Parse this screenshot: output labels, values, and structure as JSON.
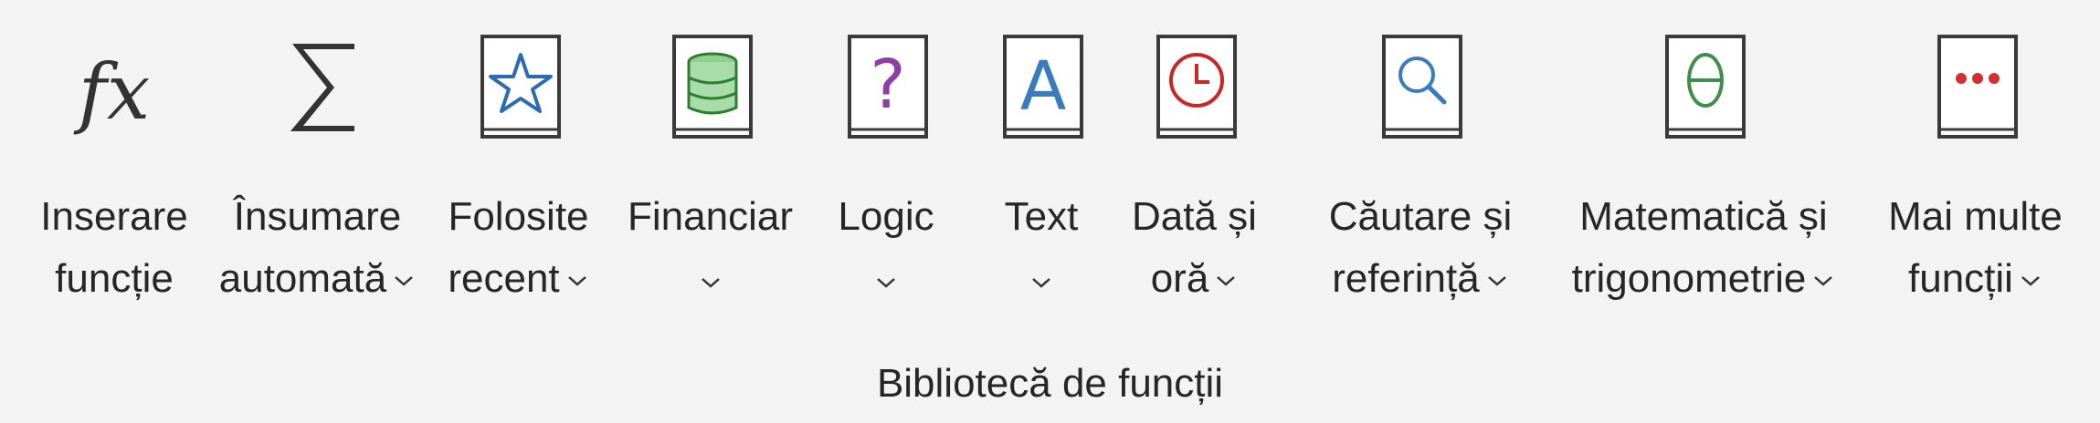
{
  "ribbon_group": {
    "label": "Bibliotecă de funcții",
    "commands": [
      {
        "line1": "Inserare",
        "line2": "funcție",
        "icon": "function-fx-icon"
      },
      {
        "line1": "Însumare",
        "line2": "automată",
        "icon": "sigma-icon",
        "dropdown": true
      },
      {
        "line1": "Folosite",
        "line2": "recent",
        "icon": "star-book-icon",
        "dropdown": true
      },
      {
        "line1": "Financiar",
        "icon": "database-book-icon",
        "dropdown": true
      },
      {
        "line1": "Logic",
        "icon": "question-book-icon",
        "dropdown": true
      },
      {
        "line1": "Text",
        "icon": "letter-a-book-icon",
        "dropdown": true
      },
      {
        "line1": "Dată și",
        "line2": "oră",
        "icon": "clock-book-icon",
        "dropdown": true
      },
      {
        "line1": "Căutare și",
        "line2": "referință",
        "icon": "search-book-icon",
        "dropdown": true
      },
      {
        "line1": "Matematică și",
        "line2": "trigonometrie",
        "icon": "theta-book-icon",
        "dropdown": true
      },
      {
        "line1": "Mai multe",
        "line2": "funcții",
        "icon": "more-dots-book-icon",
        "dropdown": true
      }
    ]
  },
  "colors": {
    "star": "#2b6cb0",
    "database": "#2e7d32",
    "question": "#8e3fa6",
    "letter": "#3a7bbf",
    "clock": "#c62828",
    "search": "#3a7bbf",
    "theta": "#3f8f4a",
    "dots": "#d32f2f",
    "outline": "#3a3a3a"
  }
}
